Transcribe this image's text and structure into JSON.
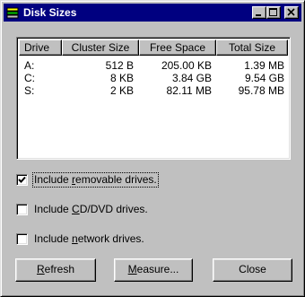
{
  "window": {
    "title": "Disk Sizes",
    "title_bar_color": "#000080",
    "controls": {
      "minimize_icon": "minimize-icon",
      "maximize_icon": "maximize-icon",
      "close_icon": "close-icon"
    }
  },
  "list": {
    "columns": [
      "Drive",
      "Cluster Size",
      "Free Space",
      "Total Size"
    ],
    "rows": [
      {
        "drive": "A:",
        "cluster": "512 B",
        "free": "205.00 KB",
        "total": "1.39 MB"
      },
      {
        "drive": "C:",
        "cluster": "8 KB",
        "free": "3.84 GB",
        "total": "9.54 GB"
      },
      {
        "drive": "S:",
        "cluster": "2 KB",
        "free": "82.11 MB",
        "total": "95.78 MB"
      }
    ]
  },
  "options": [
    {
      "before": "Include ",
      "key": "r",
      "after": "emovable drives.",
      "checked": true
    },
    {
      "before": "Include ",
      "key": "C",
      "after": "D/DVD drives.",
      "checked": false
    },
    {
      "before": "Include ",
      "key": "n",
      "after": "etwork drives.",
      "checked": false
    }
  ],
  "buttons": {
    "refresh": {
      "before": "",
      "key": "R",
      "after": "efresh"
    },
    "measure": {
      "before": "",
      "key": "M",
      "after": "easure..."
    },
    "close": {
      "label": "Close"
    }
  }
}
